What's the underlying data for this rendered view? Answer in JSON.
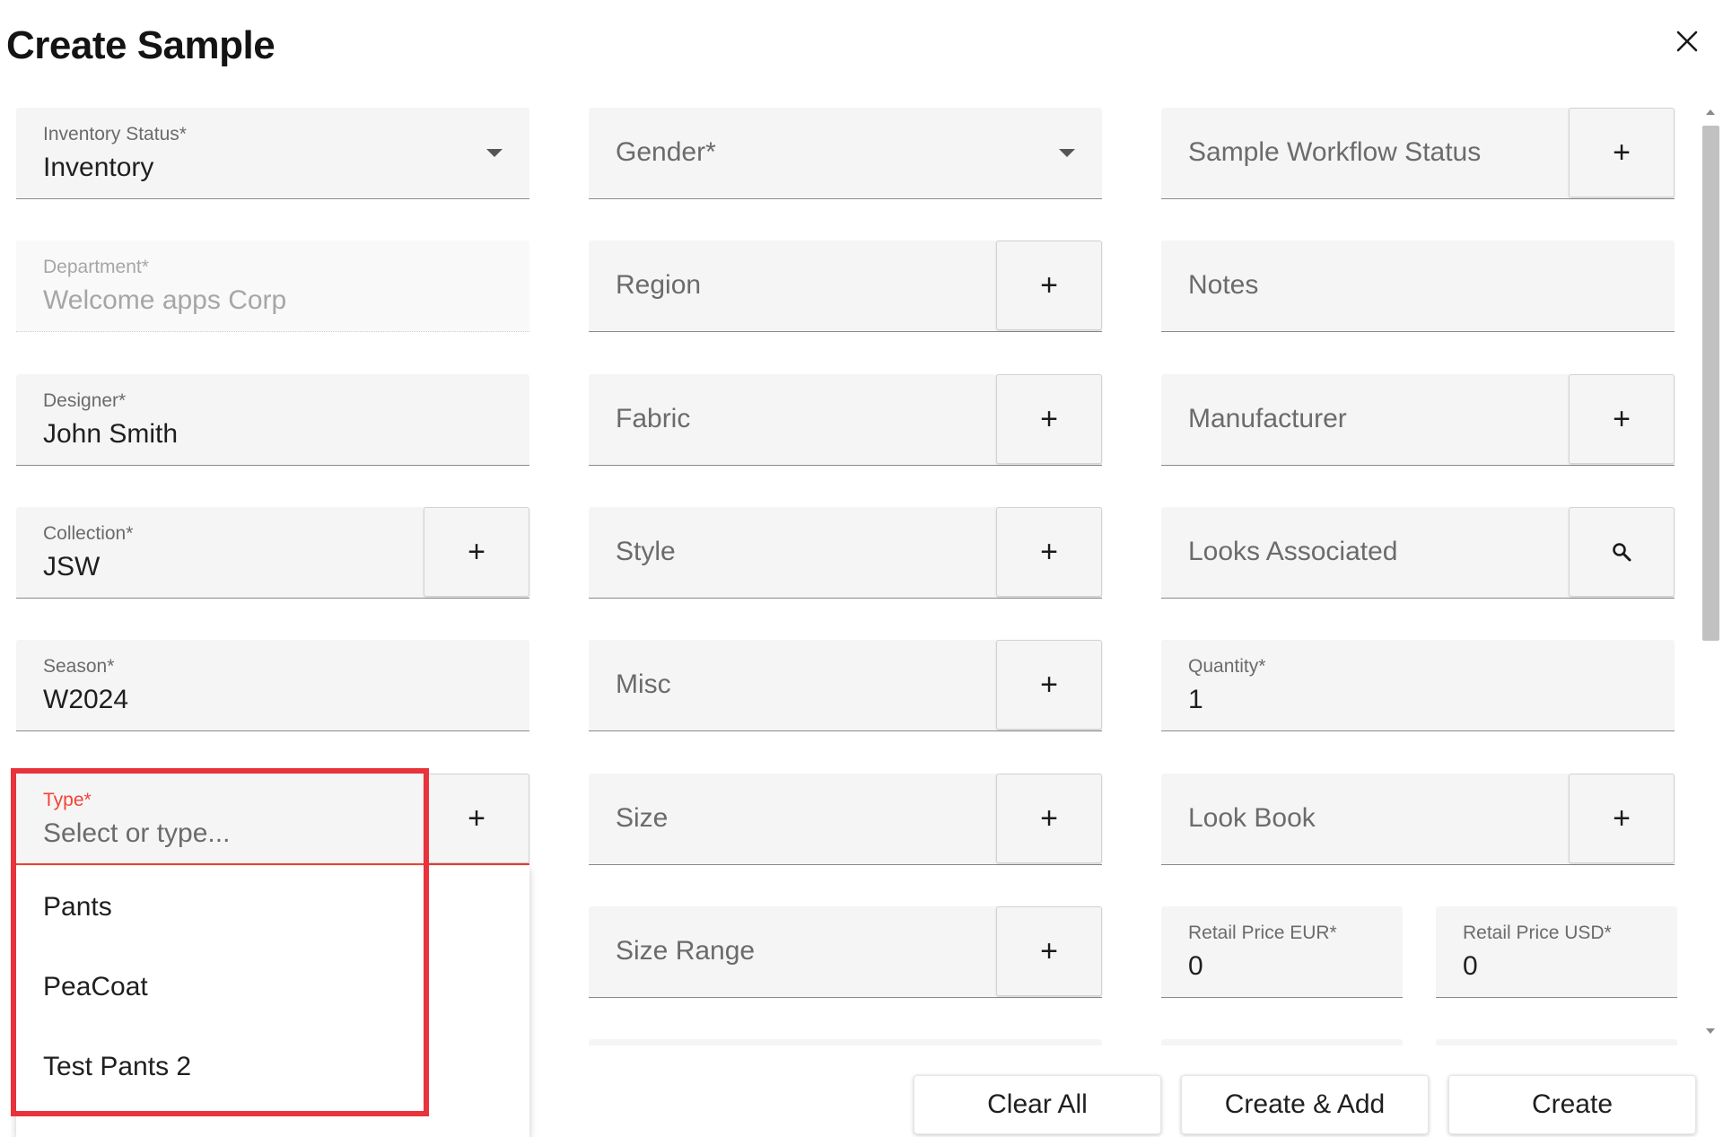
{
  "dialog": {
    "title": "Create Sample",
    "close_icon": "close-icon"
  },
  "fields": {
    "inventory_status": {
      "label": "Inventory Status*",
      "value": "Inventory"
    },
    "gender": {
      "placeholder": "Gender*"
    },
    "sample_workflow_status": {
      "placeholder": "Sample Workflow Status"
    },
    "department": {
      "label": "Department*",
      "value": "Welcome apps Corp"
    },
    "region": {
      "placeholder": "Region"
    },
    "notes": {
      "placeholder": "Notes"
    },
    "designer": {
      "label": "Designer*",
      "value": "John Smith"
    },
    "fabric": {
      "placeholder": "Fabric"
    },
    "manufacturer": {
      "placeholder": "Manufacturer"
    },
    "collection": {
      "label": "Collection*",
      "value": "JSW"
    },
    "style": {
      "placeholder": "Style"
    },
    "looks_associated": {
      "placeholder": "Looks Associated"
    },
    "season": {
      "label": "Season*",
      "value": "W2024"
    },
    "misc": {
      "placeholder": "Misc"
    },
    "quantity": {
      "label": "Quantity*",
      "value": "1"
    },
    "type": {
      "label": "Type*",
      "placeholder": "Select or type..."
    },
    "size": {
      "placeholder": "Size"
    },
    "look_book": {
      "placeholder": "Look Book"
    },
    "size_range": {
      "placeholder": "Size Range"
    },
    "retail_price_eur": {
      "label": "Retail Price EUR*",
      "value": "0"
    },
    "retail_price_usd": {
      "label": "Retail Price USD*",
      "value": "0"
    }
  },
  "addon_symbol": "+",
  "type_dropdown": {
    "options": [
      "Pants",
      "PeaCoat",
      "Test Pants 2"
    ]
  },
  "actions": {
    "clear_all": "Clear All",
    "create_and_add": "Create & Add",
    "create": "Create"
  },
  "colors": {
    "field_background": "#f5f5f5",
    "focus_accent": "#f44336",
    "highlight_box": "#e8323c",
    "text_primary": "#1f1f1f",
    "text_muted": "#6b6b6b"
  }
}
